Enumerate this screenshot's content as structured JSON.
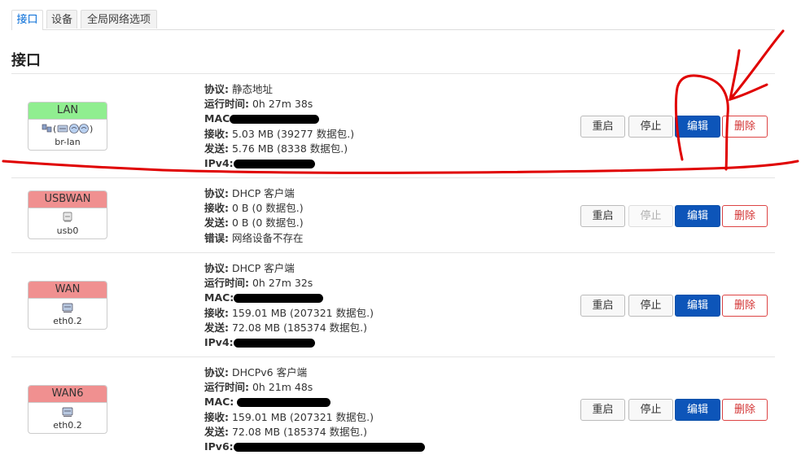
{
  "tabs": [
    "接口",
    "设备",
    "全局网络选项"
  ],
  "section_title": "接口",
  "labels": {
    "protocol": "协议:",
    "uptime": "运行时间:",
    "mac": "MAC:",
    "rx": "接收:",
    "tx": "发送:",
    "ipv4": "IPv4:",
    "ipv6": "IPv6:",
    "error": "错误:"
  },
  "buttons": {
    "restart": "重启",
    "stop": "停止",
    "edit": "编辑",
    "delete": "删除"
  },
  "interfaces": [
    {
      "name": "LAN",
      "device": "br-lan",
      "icons_text": "(  )",
      "protocol": "静态地址",
      "uptime": "0h 27m 38s",
      "rx": "5.03 MB (39277 数据包.)",
      "tx": "5.76 MB (8338 数据包.)"
    },
    {
      "name": "USBWAN",
      "device": "usb0",
      "protocol": "DHCP 客户端",
      "rx": "0 B (0 数据包.)",
      "tx": "0 B (0 数据包.)",
      "error": "网络设备不存在"
    },
    {
      "name": "WAN",
      "device": "eth0.2",
      "protocol": "DHCP 客户端",
      "uptime": "0h 27m 32s",
      "rx": "159.01 MB (207321 数据包.)",
      "tx": "72.08 MB (185374 数据包.)"
    },
    {
      "name": "WAN6",
      "device": "eth0.2",
      "protocol": "DHCPv6 客户端",
      "uptime": "0h 21m 48s",
      "rx": "159.01 MB (207321 数据包.)",
      "tx": "72.08 MB (185374 数据包.)"
    }
  ],
  "colors": {
    "accent": "#0069d6",
    "edit_button": "#0d55b9",
    "delete_text": "#d33333",
    "lan_badge": "#90ee90",
    "wan_badge": "#f09090",
    "annotation": "#e00000"
  }
}
